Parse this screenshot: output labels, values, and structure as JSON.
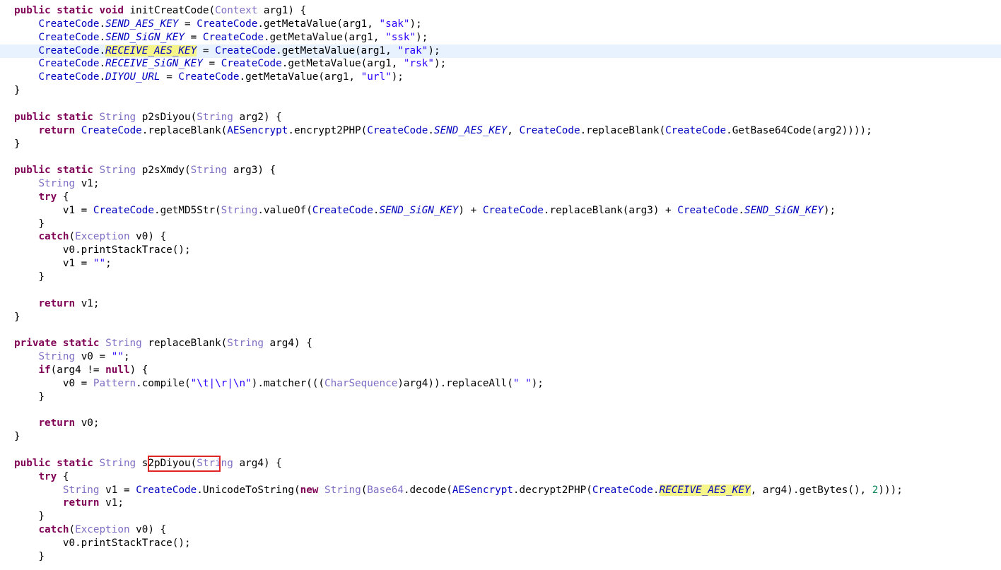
{
  "editor": {
    "lines": [
      [
        [
          "kw",
          "public static void "
        ],
        [
          "",
          "initCreatCode("
        ],
        [
          "cls",
          "Context"
        ],
        [
          "",
          " arg1) {"
        ]
      ],
      [
        [
          "",
          "    "
        ],
        [
          "cc",
          "CreateCode"
        ],
        [
          "",
          "."
        ],
        [
          "fld",
          "SEND_AES_KEY"
        ],
        [
          "",
          " = "
        ],
        [
          "cc",
          "CreateCode"
        ],
        [
          "",
          ".getMetaValue(arg1, "
        ],
        [
          "str",
          "\"sak\""
        ],
        [
          "",
          ");"
        ]
      ],
      [
        [
          "",
          "    "
        ],
        [
          "cc",
          "CreateCode"
        ],
        [
          "",
          "."
        ],
        [
          "fld",
          "SEND_SiGN_KEY"
        ],
        [
          "",
          " = "
        ],
        [
          "cc",
          "CreateCode"
        ],
        [
          "",
          ".getMetaValue(arg1, "
        ],
        [
          "str",
          "\"ssk\""
        ],
        [
          "",
          ");"
        ]
      ],
      [
        [
          "",
          "    "
        ],
        [
          "cc",
          "CreateCode"
        ],
        [
          "",
          "."
        ],
        [
          "fld hl",
          "RECEI"
        ],
        [
          "caret",
          ""
        ],
        [
          "fld hl",
          "VE_AES_KEY"
        ],
        [
          "",
          " = "
        ],
        [
          "cc",
          "CreateCode"
        ],
        [
          "",
          ".getMetaValue(arg1, "
        ],
        [
          "str",
          "\"rak\""
        ],
        [
          "",
          ");"
        ]
      ],
      [
        [
          "",
          "    "
        ],
        [
          "cc",
          "CreateCode"
        ],
        [
          "",
          "."
        ],
        [
          "fld",
          "RECEIVE_SiGN_KEY"
        ],
        [
          "",
          " = "
        ],
        [
          "cc",
          "CreateCode"
        ],
        [
          "",
          ".getMetaValue(arg1, "
        ],
        [
          "str",
          "\"rsk\""
        ],
        [
          "",
          ");"
        ]
      ],
      [
        [
          "",
          "    "
        ],
        [
          "cc",
          "CreateCode"
        ],
        [
          "",
          "."
        ],
        [
          "fld",
          "DIYOU_URL"
        ],
        [
          "",
          " = "
        ],
        [
          "cc",
          "CreateCode"
        ],
        [
          "",
          ".getMetaValue(arg1, "
        ],
        [
          "str",
          "\"url\""
        ],
        [
          "",
          ");"
        ]
      ],
      [
        [
          "",
          "}"
        ]
      ],
      [],
      [
        [
          "kw",
          "public static "
        ],
        [
          "cls",
          "String"
        ],
        [
          "",
          " p2sDiyou("
        ],
        [
          "cls",
          "String"
        ],
        [
          "",
          " arg2) {"
        ]
      ],
      [
        [
          "",
          "    "
        ],
        [
          "kw",
          "return "
        ],
        [
          "cc",
          "CreateCode"
        ],
        [
          "",
          ".replaceBlank("
        ],
        [
          "cc",
          "AESencrypt"
        ],
        [
          "",
          ".encrypt2PHP("
        ],
        [
          "cc",
          "CreateCode"
        ],
        [
          "",
          "."
        ],
        [
          "fld",
          "SEND_AES_KEY"
        ],
        [
          "",
          ", "
        ],
        [
          "cc",
          "CreateCode"
        ],
        [
          "",
          ".replaceBlank("
        ],
        [
          "cc",
          "CreateCode"
        ],
        [
          "",
          ".GetBase64Code(arg2))));"
        ]
      ],
      [
        [
          "",
          "}"
        ]
      ],
      [],
      [
        [
          "kw",
          "public static "
        ],
        [
          "cls",
          "String"
        ],
        [
          "",
          " p2sXmdy("
        ],
        [
          "cls",
          "String"
        ],
        [
          "",
          " arg3) {"
        ]
      ],
      [
        [
          "",
          "    "
        ],
        [
          "cls",
          "String"
        ],
        [
          "",
          " v1;"
        ]
      ],
      [
        [
          "",
          "    "
        ],
        [
          "kw",
          "try"
        ],
        [
          "",
          " {"
        ]
      ],
      [
        [
          "",
          "        v1 = "
        ],
        [
          "cc",
          "CreateCode"
        ],
        [
          "",
          ".getMD5Str("
        ],
        [
          "cls",
          "String"
        ],
        [
          "",
          ".valueOf("
        ],
        [
          "cc",
          "CreateCode"
        ],
        [
          "",
          "."
        ],
        [
          "fld",
          "SEND_SiGN_KEY"
        ],
        [
          "",
          ") + "
        ],
        [
          "cc",
          "CreateCode"
        ],
        [
          "",
          ".replaceBlank(arg3) + "
        ],
        [
          "cc",
          "CreateCode"
        ],
        [
          "",
          "."
        ],
        [
          "fld",
          "SEND_SiGN_KEY"
        ],
        [
          "",
          ");"
        ]
      ],
      [
        [
          "",
          "    }"
        ]
      ],
      [
        [
          "",
          "    "
        ],
        [
          "kw",
          "catch"
        ],
        [
          "",
          "("
        ],
        [
          "cls",
          "Exception"
        ],
        [
          "",
          " v0) {"
        ]
      ],
      [
        [
          "",
          "        v0.printStackTrace();"
        ]
      ],
      [
        [
          "",
          "        v1 = "
        ],
        [
          "str",
          "\"\""
        ],
        [
          "",
          ";"
        ]
      ],
      [
        [
          "",
          "    }"
        ]
      ],
      [],
      [
        [
          "",
          "    "
        ],
        [
          "kw",
          "return"
        ],
        [
          "",
          " v1;"
        ]
      ],
      [
        [
          "",
          "}"
        ]
      ],
      [],
      [
        [
          "kw",
          "private static "
        ],
        [
          "cls",
          "String"
        ],
        [
          "",
          " replaceBlank("
        ],
        [
          "cls",
          "String"
        ],
        [
          "",
          " arg4) {"
        ]
      ],
      [
        [
          "",
          "    "
        ],
        [
          "cls",
          "String"
        ],
        [
          "",
          " v0 = "
        ],
        [
          "str",
          "\"\""
        ],
        [
          "",
          ";"
        ]
      ],
      [
        [
          "",
          "    "
        ],
        [
          "kw",
          "if"
        ],
        [
          "",
          "(arg4 != "
        ],
        [
          "kw",
          "null"
        ],
        [
          "",
          ") {"
        ]
      ],
      [
        [
          "",
          "        v0 = "
        ],
        [
          "cls",
          "Pattern"
        ],
        [
          "",
          ".compile("
        ],
        [
          "str",
          "\"\\t|\\r|\\n\""
        ],
        [
          "",
          ").matcher((("
        ],
        [
          "cls",
          "CharSequence"
        ],
        [
          "",
          ")arg4)).replaceAll("
        ],
        [
          "str",
          "\" \""
        ],
        [
          "",
          ");"
        ]
      ],
      [
        [
          "",
          "    }"
        ]
      ],
      [],
      [
        [
          "",
          "    "
        ],
        [
          "kw",
          "return"
        ],
        [
          "",
          " v0;"
        ]
      ],
      [
        [
          "",
          "}"
        ]
      ],
      [],
      [
        [
          "kw",
          "public static "
        ],
        [
          "cls",
          "String"
        ],
        [
          "",
          " s2pDiyou("
        ],
        [
          "cls",
          "String"
        ],
        [
          "",
          " arg4) {"
        ]
      ],
      [
        [
          "",
          "    "
        ],
        [
          "kw",
          "try"
        ],
        [
          "",
          " {"
        ]
      ],
      [
        [
          "",
          "        "
        ],
        [
          "cls",
          "String"
        ],
        [
          "",
          " v1 = "
        ],
        [
          "cc",
          "CreateCode"
        ],
        [
          "",
          ".UnicodeToString("
        ],
        [
          "kw",
          "new "
        ],
        [
          "cls",
          "String"
        ],
        [
          "",
          "("
        ],
        [
          "cls",
          "Base64"
        ],
        [
          "",
          ".decode("
        ],
        [
          "cc",
          "AESencrypt"
        ],
        [
          "",
          ".decrypt2PHP("
        ],
        [
          "cc",
          "CreateCode"
        ],
        [
          "",
          "."
        ],
        [
          "fld hl",
          "RECEIVE_AES_KEY"
        ],
        [
          "",
          ", arg4).getBytes(), "
        ],
        [
          "num",
          "2"
        ],
        [
          "",
          ")));"
        ]
      ],
      [
        [
          "",
          "        "
        ],
        [
          "kw",
          "return"
        ],
        [
          "",
          " v1;"
        ]
      ],
      [
        [
          "",
          "    }"
        ]
      ],
      [
        [
          "",
          "    "
        ],
        [
          "kw",
          "catch"
        ],
        [
          "",
          "("
        ],
        [
          "cls",
          "Exception"
        ],
        [
          "",
          " v0) {"
        ]
      ],
      [
        [
          "",
          "        v0.printStackTrace();"
        ]
      ],
      [
        [
          "",
          "    }"
        ]
      ]
    ],
    "current_line_index": 3,
    "highlighted_method": "s2pDiyou(",
    "colors": {
      "keyword": "#7f0055",
      "class_name": "#7f6ec4",
      "type_reference": "#0000c0",
      "static_field": "#0000c0",
      "string_literal": "#2a00ff",
      "number_literal": "#098658",
      "occurrence_highlight": "#f6f58a",
      "current_line": "#e8f2fe",
      "annotation_box": "#e02525"
    }
  }
}
